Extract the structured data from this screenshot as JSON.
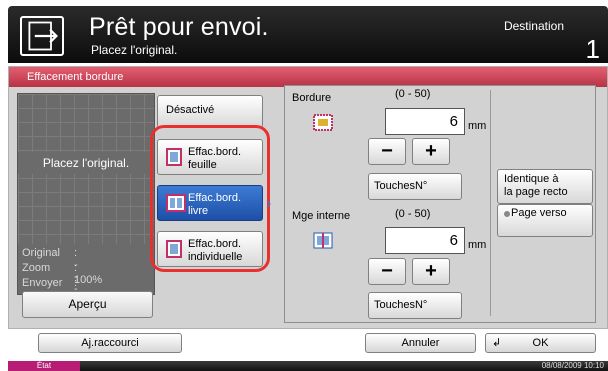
{
  "header": {
    "title": "Prêt pour envoi.",
    "subtitle": "Placez l'original.",
    "destination_label": "Destination",
    "destination_count": "1"
  },
  "panel": {
    "title": "Effacement bordure",
    "preview_message": "Placez l'original.",
    "info": [
      {
        "label": "Original",
        "value": ": ---"
      },
      {
        "label": "Zoom",
        "value": ": 100%"
      },
      {
        "label": "Envoyer",
        "value": ": ---"
      }
    ],
    "apercu_label": "Aperçu"
  },
  "modes": {
    "disabled": "Désactivé",
    "sheet": [
      "Effac.bord.",
      "feuille"
    ],
    "book": [
      "Effac.bord.",
      "livre"
    ],
    "individual": [
      "Effac.bord.",
      "individuelle"
    ],
    "selected": "book"
  },
  "settings": {
    "border_label": "Bordure",
    "border_range": "(0 - 50)",
    "border_value": "6",
    "unit": "mm",
    "minus": "−",
    "plus": "+",
    "keys_label": "TouchesN°",
    "inner_label": "Mge interne",
    "inner_range": "(0 - 50)",
    "inner_value": "6",
    "same_as_front": [
      "Identique à",
      "la page recto"
    ],
    "back_page": "Page verso"
  },
  "footer": {
    "shortcut": "Aj.raccourci",
    "cancel": "Annuler",
    "ok": "OK",
    "status": "État",
    "datetime": "08/08/2009    10:10"
  },
  "colors": {
    "accent_red": "#e8302f",
    "selected_blue": "#2458b3",
    "status_magenta": "#b71d74"
  }
}
